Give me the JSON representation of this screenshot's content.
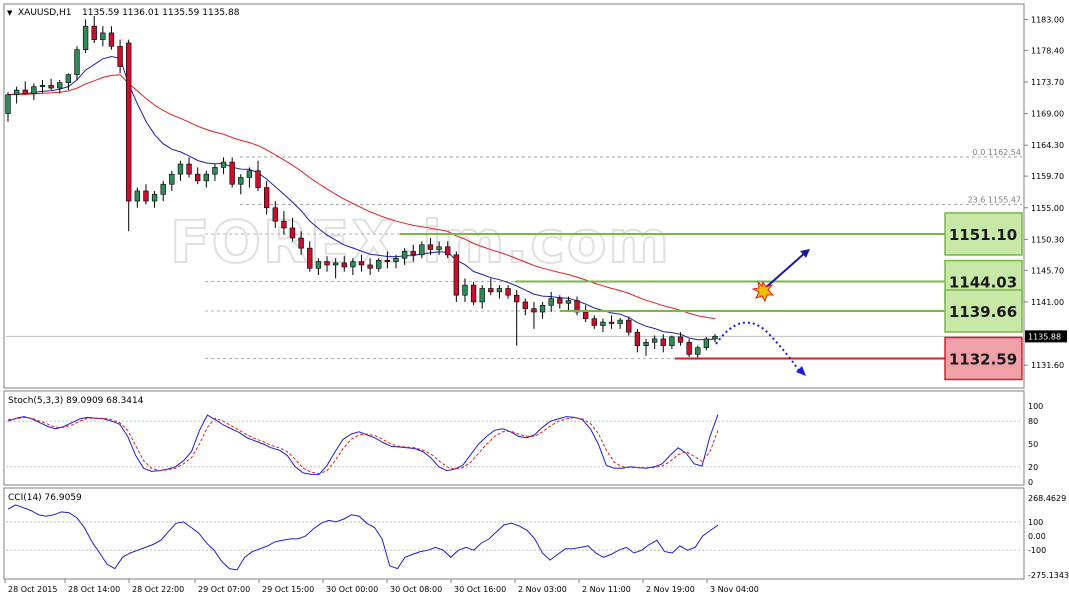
{
  "header": {
    "symbol": "XAUUSD,H1",
    "ohlc": "1135.59 1136.01 1135.59 1135.88"
  },
  "watermark": "FOREX.im.com",
  "chart_data": [
    {
      "type": "candlestick",
      "symbol": "XAUUSD",
      "timeframe": "H1",
      "ylim": [
        1128.5,
        1185
      ],
      "y_ticks": [
        "1183.00",
        "1178.40",
        "1173.70",
        "1169.00",
        "1164.30",
        "1159.70",
        "1155.00",
        "1150.30",
        "1145.70",
        "1141.00",
        "1131.60"
      ],
      "current_price": "1135.88",
      "x_labels": [
        "28 Oct 2015",
        "28 Oct 14:00",
        "28 Oct 22:00",
        "29 Oct 07:00",
        "29 Oct 15:00",
        "30 Oct 00:00",
        "30 Oct 08:00",
        "30 Oct 16:00",
        "2 Nov 03:00",
        "2 Nov 11:00",
        "2 Nov 19:00",
        "3 Nov 04:00"
      ],
      "ohlc": [
        [
          1169.0,
          1172.2,
          1167.8,
          1171.8
        ],
        [
          1171.8,
          1173.0,
          1170.5,
          1172.5
        ],
        [
          1172.5,
          1173.8,
          1171.8,
          1172.0
        ],
        [
          1172.0,
          1173.5,
          1171.0,
          1173.0
        ],
        [
          1173.0,
          1174.0,
          1172.0,
          1173.2
        ],
        [
          1173.2,
          1174.2,
          1172.5,
          1172.8
        ],
        [
          1172.8,
          1174.0,
          1172.0,
          1173.6
        ],
        [
          1173.6,
          1175.0,
          1172.5,
          1174.8
        ],
        [
          1174.8,
          1179.0,
          1174.0,
          1178.5
        ],
        [
          1178.5,
          1183.0,
          1178.0,
          1182.0
        ],
        [
          1182.0,
          1183.5,
          1179.5,
          1180.0
        ],
        [
          1180.0,
          1182.0,
          1179.0,
          1181.0
        ],
        [
          1181.0,
          1182.0,
          1178.5,
          1179.0
        ],
        [
          1179.0,
          1180.0,
          1175.0,
          1176.0
        ],
        [
          1179.5,
          1180.0,
          1151.5,
          1156.0
        ],
        [
          1156.0,
          1158.0,
          1155.0,
          1157.5
        ],
        [
          1157.5,
          1158.5,
          1155.5,
          1156.0
        ],
        [
          1156.0,
          1157.5,
          1155.0,
          1157.0
        ],
        [
          1157.0,
          1159.0,
          1156.0,
          1158.5
        ],
        [
          1158.5,
          1160.5,
          1157.5,
          1160.0
        ],
        [
          1160.0,
          1162.0,
          1159.0,
          1161.5
        ],
        [
          1161.5,
          1162.5,
          1159.5,
          1160.0
        ],
        [
          1160.0,
          1161.0,
          1158.5,
          1159.0
        ],
        [
          1159.0,
          1160.5,
          1158.0,
          1160.0
        ],
        [
          1160.0,
          1161.5,
          1159.0,
          1161.0
        ],
        [
          1161.0,
          1162.5,
          1160.0,
          1161.8
        ],
        [
          1161.8,
          1162.5,
          1158.0,
          1158.5
        ],
        [
          1158.5,
          1160.0,
          1157.0,
          1159.5
        ],
        [
          1159.5,
          1161.0,
          1158.0,
          1160.5
        ],
        [
          1160.5,
          1162.0,
          1157.5,
          1158.0
        ],
        [
          1158.0,
          1159.0,
          1154.0,
          1155.0
        ],
        [
          1155.0,
          1156.0,
          1152.0,
          1153.0
        ],
        [
          1153.0,
          1154.5,
          1151.0,
          1152.0
        ],
        [
          1152.0,
          1153.5,
          1150.0,
          1150.5
        ],
        [
          1150.5,
          1151.5,
          1148.0,
          1149.0
        ],
        [
          1149.0,
          1150.0,
          1145.5,
          1146.0
        ],
        [
          1146.0,
          1147.5,
          1145.0,
          1147.0
        ],
        [
          1147.0,
          1147.8,
          1145.5,
          1146.5
        ],
        [
          1146.5,
          1147.5,
          1144.5,
          1146.8
        ],
        [
          1146.8,
          1147.8,
          1145.5,
          1146.2
        ],
        [
          1146.2,
          1147.5,
          1145.0,
          1147.0
        ],
        [
          1147.0,
          1148.0,
          1145.5,
          1146.5
        ],
        [
          1146.5,
          1147.5,
          1145.0,
          1146.0
        ],
        [
          1146.0,
          1147.5,
          1145.5,
          1147.2
        ],
        [
          1147.2,
          1148.5,
          1146.0,
          1147.0
        ],
        [
          1147.0,
          1148.0,
          1146.0,
          1147.5
        ],
        [
          1147.5,
          1149.0,
          1146.5,
          1148.5
        ],
        [
          1148.5,
          1149.5,
          1147.0,
          1148.0
        ],
        [
          1148.0,
          1150.0,
          1147.5,
          1149.5
        ],
        [
          1149.5,
          1150.5,
          1148.0,
          1148.8
        ],
        [
          1148.8,
          1150.0,
          1148.0,
          1149.2
        ],
        [
          1149.2,
          1150.0,
          1147.5,
          1148.0
        ],
        [
          1148.0,
          1148.5,
          1141.0,
          1142.0
        ],
        [
          1142.0,
          1144.5,
          1141.0,
          1143.5
        ],
        [
          1143.5,
          1144.0,
          1140.5,
          1141.0
        ],
        [
          1141.0,
          1143.5,
          1140.0,
          1143.0
        ],
        [
          1143.0,
          1144.5,
          1142.0,
          1142.5
        ],
        [
          1142.5,
          1143.5,
          1141.5,
          1143.0
        ],
        [
          1143.0,
          1143.5,
          1141.5,
          1142.0
        ],
        [
          1142.0,
          1142.8,
          1134.5,
          1141.0
        ],
        [
          1141.0,
          1141.5,
          1139.0,
          1140.0
        ],
        [
          1140.0,
          1141.0,
          1137.0,
          1139.5
        ],
        [
          1139.5,
          1141.0,
          1138.5,
          1140.5
        ],
        [
          1140.5,
          1142.5,
          1139.5,
          1141.5
        ],
        [
          1141.5,
          1142.0,
          1140.0,
          1140.8
        ],
        [
          1140.8,
          1141.8,
          1139.5,
          1141.2
        ],
        [
          1141.2,
          1141.8,
          1139.0,
          1139.5
        ],
        [
          1139.5,
          1140.5,
          1138.0,
          1138.5
        ],
        [
          1138.5,
          1139.0,
          1137.0,
          1137.5
        ],
        [
          1137.5,
          1138.5,
          1136.5,
          1138.0
        ],
        [
          1138.0,
          1139.0,
          1137.0,
          1137.8
        ],
        [
          1137.8,
          1138.6,
          1137.0,
          1138.3
        ],
        [
          1138.3,
          1138.8,
          1136.0,
          1136.5
        ],
        [
          1136.5,
          1137.0,
          1133.5,
          1134.5
        ],
        [
          1134.5,
          1135.5,
          1133.0,
          1135.0
        ],
        [
          1135.0,
          1136.0,
          1134.0,
          1135.5
        ],
        [
          1135.5,
          1136.2,
          1133.5,
          1134.5
        ],
        [
          1134.5,
          1136.0,
          1134.0,
          1135.8
        ],
        [
          1135.8,
          1136.5,
          1134.5,
          1135.0
        ],
        [
          1135.0,
          1135.5,
          1132.8,
          1133.2
        ],
        [
          1133.2,
          1134.5,
          1132.6,
          1134.2
        ],
        [
          1134.2,
          1135.8,
          1133.8,
          1135.5
        ],
        [
          1135.5,
          1136.2,
          1135.0,
          1135.9
        ]
      ],
      "indicators": {
        "ma_fast_color": "#1f1fa8",
        "ma_slow_color": "#e02020",
        "fibonacci": [
          {
            "label": "0.0  1162.54",
            "value": 1162.54
          },
          {
            "label": "23.6  1155.47",
            "value": 1155.47
          }
        ]
      },
      "levels": [
        {
          "value": 1151.1,
          "label": "1151.10",
          "kind": "resistance"
        },
        {
          "value": 1144.03,
          "label": "1144.03",
          "kind": "resistance"
        },
        {
          "value": 1139.66,
          "label": "1139.66",
          "kind": "resistance"
        },
        {
          "value": 1132.59,
          "label": "1132.59",
          "kind": "support"
        }
      ],
      "colors": {
        "resistance": "#7ab648",
        "resistance_fill": "#c8e8a8",
        "support": "#d02030",
        "support_fill": "#f0a0a8",
        "bull": "#2e8b57",
        "bear": "#c8102e"
      }
    },
    {
      "type": "line",
      "name": "Stoch(5,3,3) 89.0909 68.3414",
      "ylim": [
        0,
        100
      ],
      "y_ticks": [
        "100",
        "80",
        "50",
        "20",
        "0"
      ],
      "series": [
        {
          "values": [
            80,
            84,
            86,
            83,
            78,
            73,
            70,
            73,
            78,
            83,
            85,
            84,
            83,
            80,
            76,
            60,
            35,
            18,
            14,
            15,
            17,
            20,
            28,
            40,
            68,
            88,
            82,
            75,
            70,
            65,
            58,
            54,
            50,
            45,
            42,
            35,
            20,
            12,
            10,
            10,
            22,
            40,
            56,
            63,
            66,
            62,
            58,
            52,
            47,
            46,
            45,
            44,
            40,
            32,
            20,
            15,
            17,
            22,
            36,
            50,
            60,
            68,
            70,
            66,
            60,
            58,
            62,
            72,
            80,
            83,
            86,
            85,
            82,
            70,
            50,
            22,
            18,
            18,
            20,
            19,
            18,
            20,
            24,
            35,
            45,
            38,
            24,
            21,
            60,
            89
          ]
        },
        {
          "values": [
            82,
            83,
            85,
            84,
            80,
            76,
            72,
            72,
            75,
            80,
            84,
            84,
            84,
            82,
            78,
            68,
            48,
            28,
            18,
            15,
            16,
            18,
            24,
            32,
            50,
            72,
            84,
            80,
            74,
            68,
            62,
            57,
            53,
            48,
            45,
            40,
            30,
            18,
            13,
            11,
            15,
            28,
            44,
            56,
            62,
            63,
            61,
            56,
            50,
            47,
            46,
            45,
            42,
            37,
            28,
            20,
            17,
            19,
            26,
            38,
            50,
            60,
            66,
            67,
            63,
            60,
            60,
            66,
            74,
            80,
            83,
            85,
            83,
            77,
            64,
            42,
            26,
            20,
            19,
            19,
            19,
            19,
            21,
            27,
            36,
            40,
            34,
            27,
            40,
            68
          ]
        }
      ]
    },
    {
      "type": "line",
      "name": "CCI(14) 76.9059",
      "ylim": [
        -275.1343,
        268.4629
      ],
      "y_ticks": [
        "268.4629",
        "100",
        "0.00",
        "-100",
        "-275.1343"
      ],
      "series": [
        {
          "values": [
            190,
            220,
            200,
            180,
            150,
            140,
            150,
            170,
            165,
            130,
            60,
            -40,
            -120,
            -200,
            -230,
            -150,
            -120,
            -100,
            -80,
            -60,
            -30,
            30,
            90,
            100,
            60,
            20,
            -50,
            -100,
            -180,
            -230,
            -240,
            -150,
            -110,
            -90,
            -70,
            -40,
            -30,
            -20,
            -20,
            0,
            50,
            90,
            110,
            100,
            120,
            150,
            140,
            90,
            60,
            -20,
            -210,
            -230,
            -150,
            -130,
            -110,
            -100,
            -80,
            -100,
            -150,
            -100,
            -80,
            -100,
            -50,
            -20,
            30,
            80,
            90,
            70,
            40,
            -20,
            -120,
            -170,
            -130,
            -90,
            -90,
            -80,
            -70,
            -120,
            -150,
            -130,
            -100,
            -80,
            -120,
            -100,
            -60,
            -30,
            -110,
            -120,
            -70,
            -100,
            -80,
            0,
            40,
            77
          ]
        }
      ]
    }
  ]
}
